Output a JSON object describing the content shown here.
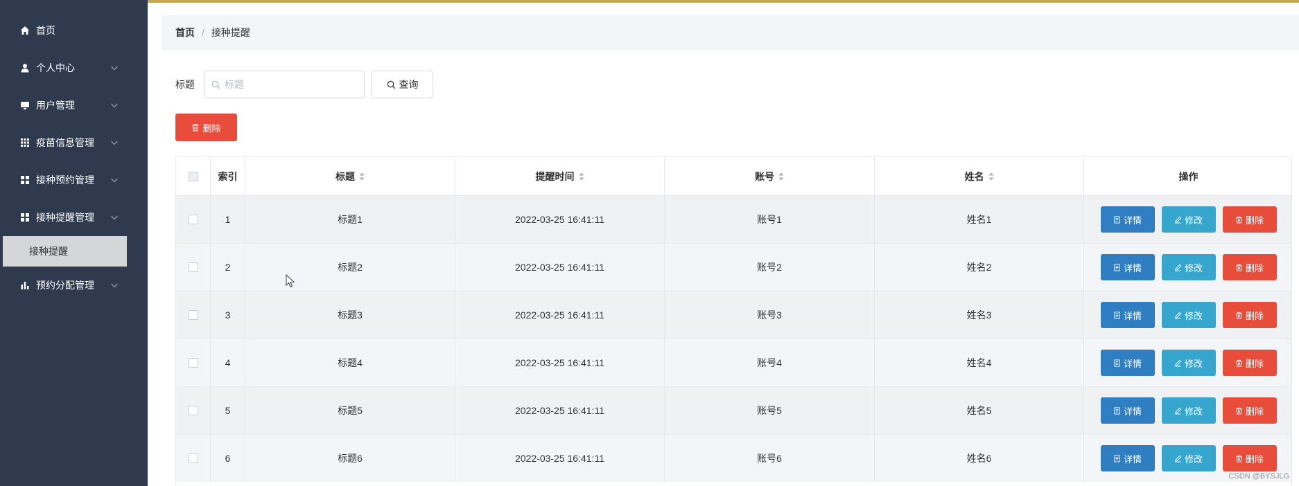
{
  "sidebar": {
    "items": [
      {
        "label": "首页",
        "icon": "home-icon",
        "has_arrow": false
      },
      {
        "label": "个人中心",
        "icon": "user-icon",
        "has_arrow": true
      },
      {
        "label": "用户管理",
        "icon": "monitor-icon",
        "has_arrow": true
      },
      {
        "label": "疫苗信息管理",
        "icon": "grid-icon",
        "has_arrow": true
      },
      {
        "label": "接种预约管理",
        "icon": "apps-icon",
        "has_arrow": true
      },
      {
        "label": "接种提醒管理",
        "icon": "apps-icon",
        "has_arrow": true
      },
      {
        "label": "预约分配管理",
        "icon": "bar-chart-icon",
        "has_arrow": true
      }
    ],
    "submenu": {
      "label": "接种提醒",
      "active": true
    }
  },
  "breadcrumb": {
    "home": "首页",
    "separator": "/",
    "current": "接种提醒"
  },
  "search": {
    "label": "标题",
    "placeholder": "标题",
    "value": "",
    "button_label": "查询"
  },
  "toolbar": {
    "delete_label": "删除"
  },
  "table": {
    "columns": [
      "索引",
      "标题",
      "提醒时间",
      "账号",
      "姓名",
      "操作"
    ],
    "rows": [
      {
        "index": "1",
        "title": "标题1",
        "time": "2022-03-25 16:41:11",
        "account": "账号1",
        "name": "姓名1"
      },
      {
        "index": "2",
        "title": "标题2",
        "time": "2022-03-25 16:41:11",
        "account": "账号2",
        "name": "姓名2"
      },
      {
        "index": "3",
        "title": "标题3",
        "time": "2022-03-25 16:41:11",
        "account": "账号3",
        "name": "姓名3"
      },
      {
        "index": "4",
        "title": "标题4",
        "time": "2022-03-25 16:41:11",
        "account": "账号4",
        "name": "姓名4"
      },
      {
        "index": "5",
        "title": "标题5",
        "time": "2022-03-25 16:41:11",
        "account": "账号5",
        "name": "姓名5"
      },
      {
        "index": "6",
        "title": "标题6",
        "time": "2022-03-25 16:41:11",
        "account": "账号6",
        "name": "姓名6"
      }
    ],
    "actions": {
      "detail": "详情",
      "edit": "修改",
      "delete": "删除"
    }
  },
  "watermark": "CSDN @BYSJLG",
  "colors": {
    "sidebar_bg": "#2f3a4e",
    "primary": "#2f7ec1",
    "info": "#36a6cf",
    "danger": "#e84d3c"
  }
}
